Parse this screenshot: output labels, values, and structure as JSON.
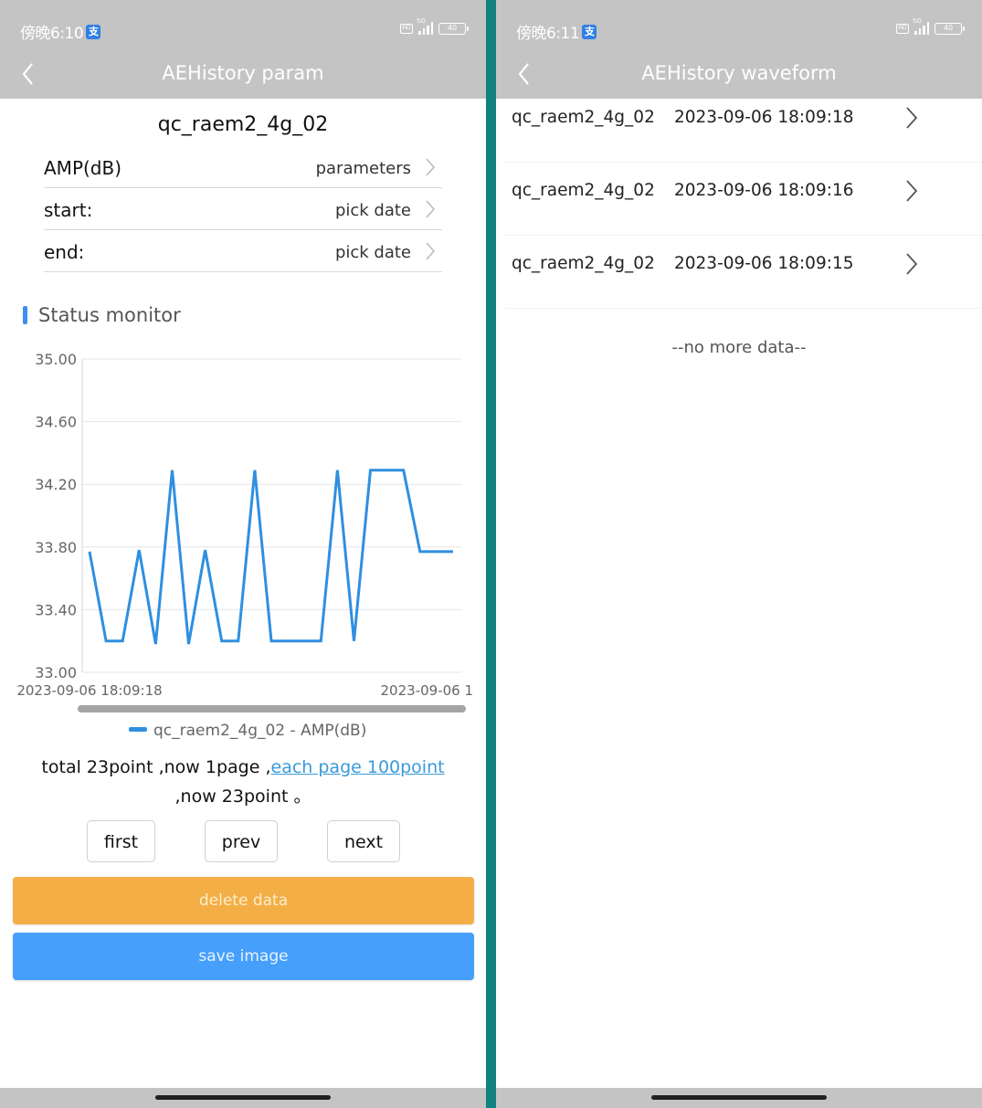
{
  "left_screen": {
    "status_bar": {
      "time": "傍晚6:10",
      "app_badge": "支",
      "network": "5G",
      "battery": "40"
    },
    "nav": {
      "title": "AEHistory param",
      "back_icon": "chevron-left-icon"
    },
    "device_name": "qc_raem2_4g_02",
    "params": [
      {
        "label": "AMP(dB)",
        "value": "parameters"
      },
      {
        "label": "start:",
        "value": "pick date"
      },
      {
        "label": "end:",
        "value": "pick date"
      }
    ],
    "section_title": "Status monitor",
    "pager": {
      "text_prefix": "total 23point ,now 1page ,",
      "link_text": "each page 100point",
      "text_suffix": ",now 23point 。",
      "first_label": "first",
      "prev_label": "prev",
      "next_label": "next"
    },
    "delete_label": "delete data",
    "save_label": "save image"
  },
  "right_screen": {
    "status_bar": {
      "time": "傍晚6:11",
      "app_badge": "支",
      "network": "5G",
      "battery": "40"
    },
    "nav": {
      "title": "AEHistory waveform",
      "back_icon": "chevron-left-icon"
    },
    "items": [
      {
        "device": "qc_raem2_4g_02",
        "timestamp": "2023-09-06 18:09:18"
      },
      {
        "device": "qc_raem2_4g_02",
        "timestamp": "2023-09-06 18:09:16"
      },
      {
        "device": "qc_raem2_4g_02",
        "timestamp": "2023-09-06 18:09:15"
      }
    ],
    "no_more": "--no more data--"
  },
  "colors": {
    "line": "#2f8fe0",
    "header_bg": "#c4c4c4",
    "divider": "#11827f",
    "delete": "#f3ab3c",
    "save": "#3d9bfb",
    "link": "#3a9ad9"
  },
  "chart_data": {
    "type": "line",
    "title": "",
    "xlabel": "",
    "ylabel": "",
    "ylim": [
      33.0,
      35.0
    ],
    "yticks": [
      "35.00",
      "34.60",
      "34.20",
      "33.80",
      "33.40",
      "33.00"
    ],
    "x_tick_labels": [
      "2023-09-06 18:09:18",
      "2023-09-06 1"
    ],
    "grid": true,
    "legend_position": "bottom",
    "scroll_position": 0,
    "series": [
      {
        "name": "qc_raem2_4g_02 - AMP(dB)",
        "values": [
          33.77,
          33.2,
          33.2,
          33.78,
          33.18,
          34.29,
          33.18,
          33.78,
          33.2,
          33.2,
          34.29,
          33.2,
          33.2,
          33.2,
          33.2,
          34.29,
          33.2,
          34.29,
          34.29,
          34.29,
          33.77,
          33.77,
          33.77
        ]
      }
    ]
  }
}
